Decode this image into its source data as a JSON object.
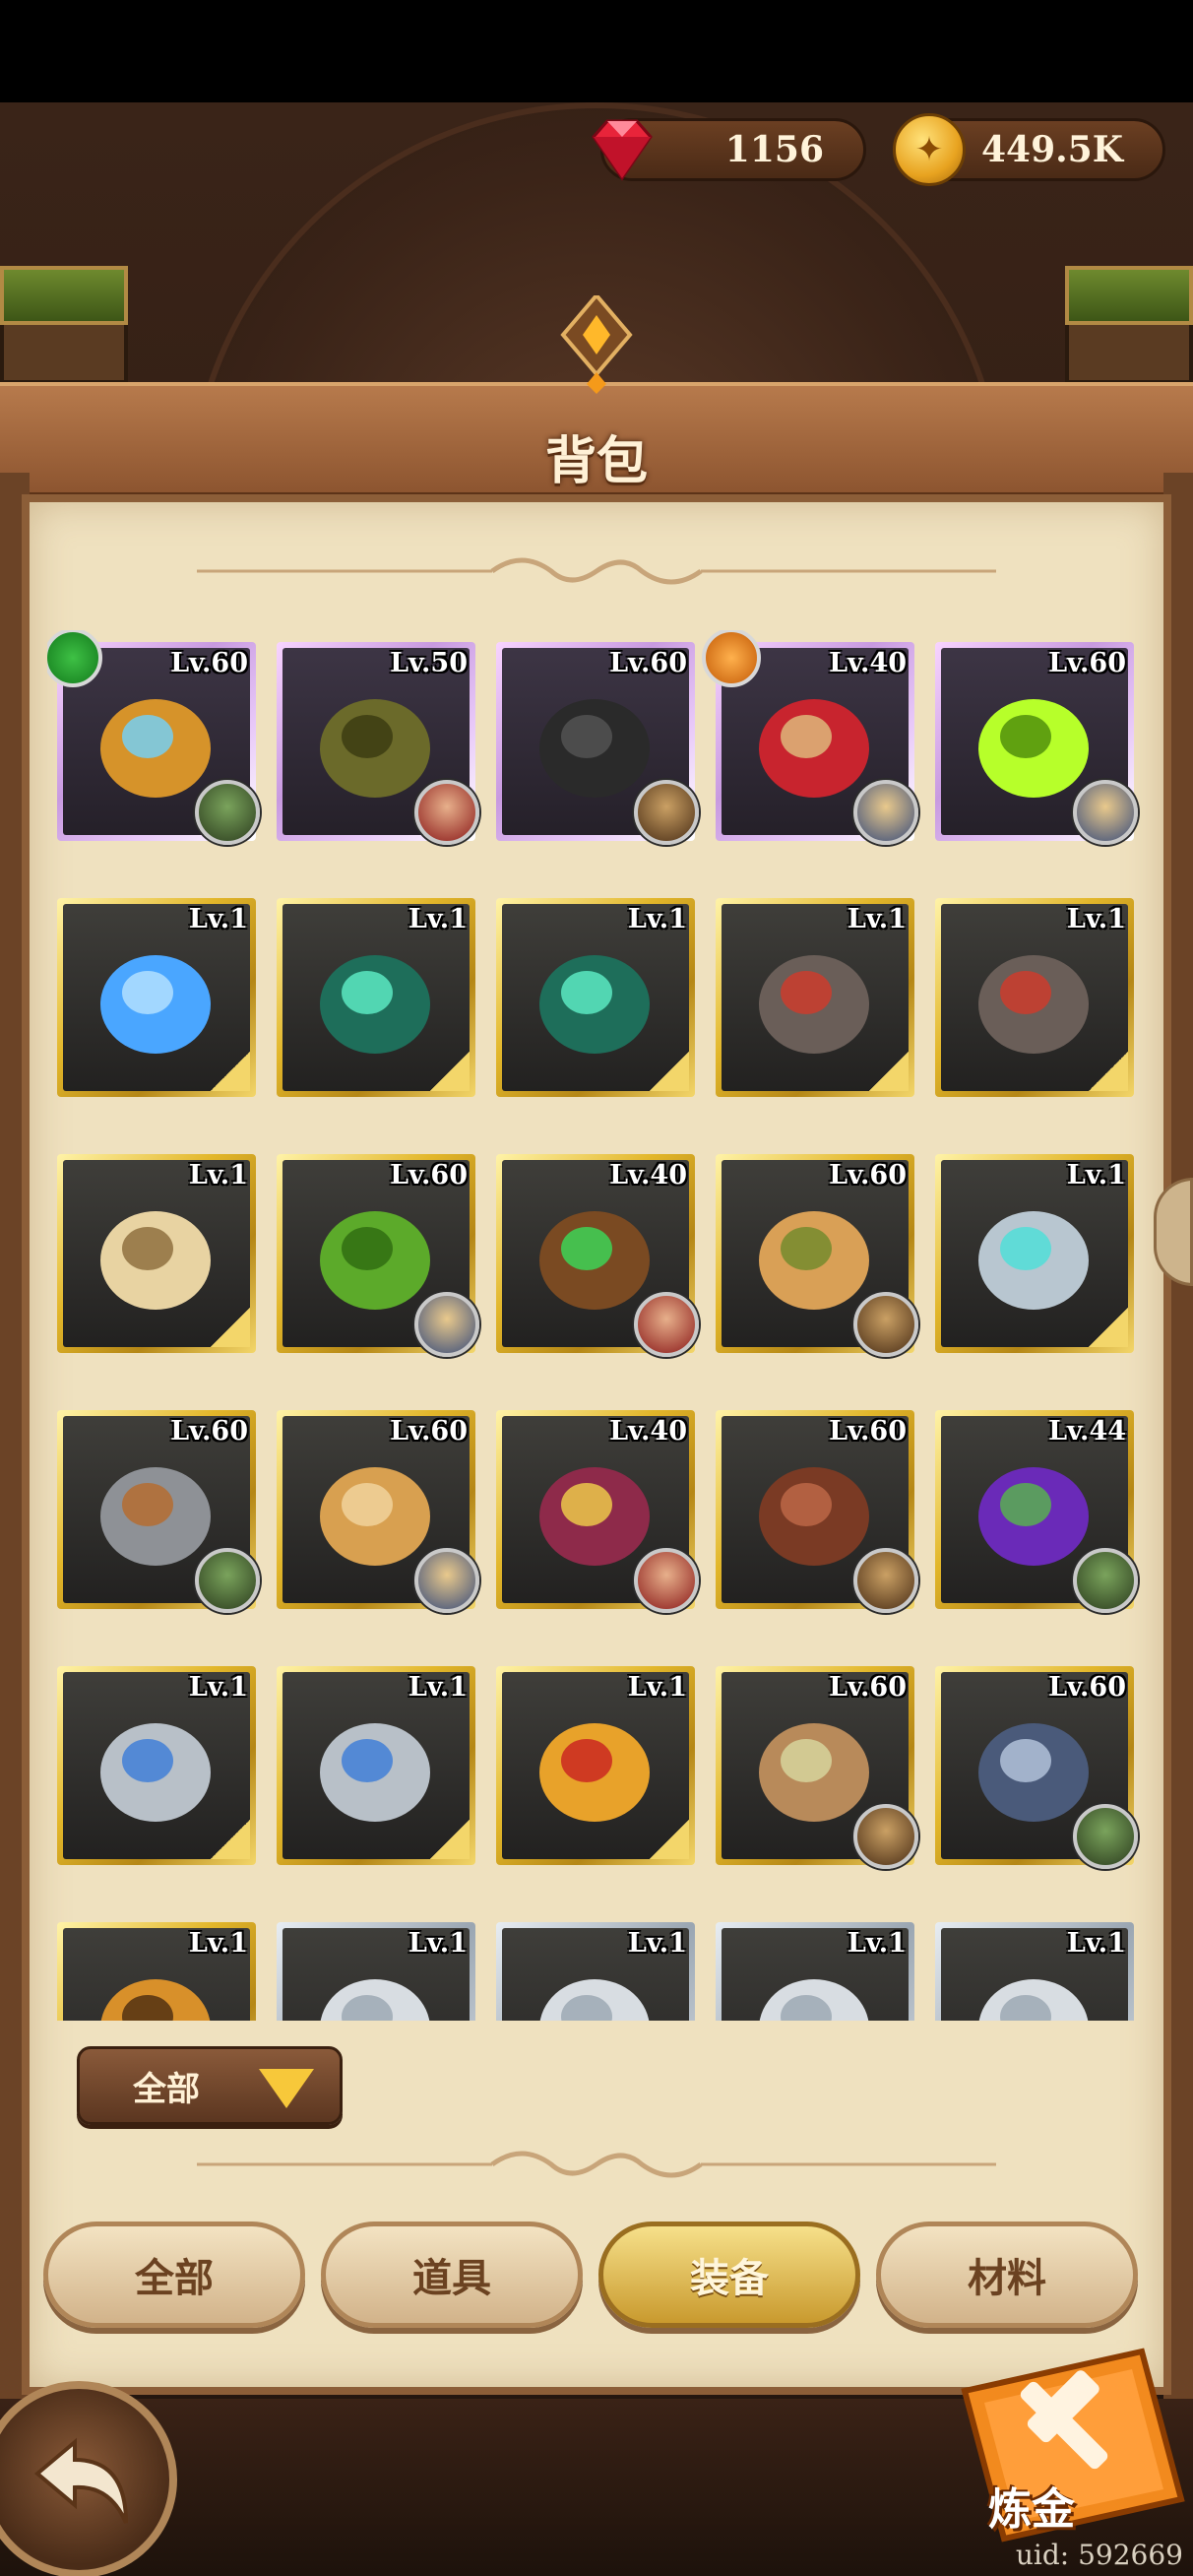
{
  "currencies": {
    "gems": {
      "value": "1156",
      "icon": "gem-icon"
    },
    "gold": {
      "value": "449.5K",
      "icon": "coin-icon"
    }
  },
  "title": "背包",
  "items": [
    {
      "level": "Lv.60",
      "frame": "purple",
      "hero": "green",
      "badge": "green",
      "art": "horn"
    },
    {
      "level": "Lv.50",
      "frame": "purple",
      "hero": "red",
      "art": "thorn-crown"
    },
    {
      "level": "Lv.60",
      "frame": "purple",
      "hero": "brown",
      "art": "horse"
    },
    {
      "level": "Lv.40",
      "frame": "purple",
      "hero": "blue",
      "badge": "orange",
      "art": "scepter"
    },
    {
      "level": "Lv.60",
      "frame": "purple",
      "hero": "blue",
      "art": "green-orb"
    },
    {
      "level": "Lv.1",
      "frame": "gold",
      "art": "blue-gem"
    },
    {
      "level": "Lv.1",
      "frame": "gold",
      "art": "teal-flame"
    },
    {
      "level": "Lv.1",
      "frame": "gold",
      "art": "teal-flame"
    },
    {
      "level": "Lv.1",
      "frame": "gold",
      "art": "rock"
    },
    {
      "level": "Lv.1",
      "frame": "gold",
      "art": "rock"
    },
    {
      "level": "Lv.1",
      "frame": "gold",
      "art": "map"
    },
    {
      "level": "Lv.60",
      "frame": "gold",
      "hero": "blue",
      "art": "turtle-shell"
    },
    {
      "level": "Lv.40",
      "frame": "gold",
      "hero": "red",
      "art": "vine-ring"
    },
    {
      "level": "Lv.60",
      "frame": "gold",
      "hero": "brown",
      "art": "straw-hat"
    },
    {
      "level": "Lv.1",
      "frame": "gold",
      "art": "fan"
    },
    {
      "level": "Lv.60",
      "frame": "gold",
      "hero": "green",
      "art": "helmet"
    },
    {
      "level": "Lv.60",
      "frame": "gold",
      "hero": "blue",
      "art": "tunic"
    },
    {
      "level": "Lv.40",
      "frame": "gold",
      "hero": "red",
      "art": "cape"
    },
    {
      "level": "Lv.60",
      "frame": "gold",
      "hero": "brown",
      "art": "leather-armor"
    },
    {
      "level": "Lv.44",
      "frame": "gold",
      "hero": "green",
      "art": "purple-armor"
    },
    {
      "level": "Lv.1",
      "frame": "gold",
      "art": "plate-armor"
    },
    {
      "level": "Lv.1",
      "frame": "gold",
      "art": "plate-armor"
    },
    {
      "level": "Lv.1",
      "frame": "gold",
      "art": "sword"
    },
    {
      "level": "Lv.60",
      "frame": "gold",
      "hero": "brown",
      "art": "bow"
    },
    {
      "level": "Lv.60",
      "frame": "gold",
      "hero": "green",
      "art": "mace"
    },
    {
      "level": "Lv.1",
      "frame": "gold",
      "art": "flames"
    },
    {
      "level": "Lv.1",
      "frame": "silver",
      "art": "hood"
    },
    {
      "level": "Lv.1",
      "frame": "silver",
      "art": "hood"
    },
    {
      "level": "Lv.1",
      "frame": "silver",
      "art": "hood"
    },
    {
      "level": "Lv.1",
      "frame": "silver",
      "art": "hood"
    }
  ],
  "filter": {
    "label": "全部"
  },
  "tabs": [
    {
      "label": "全部",
      "active": false
    },
    {
      "label": "道具",
      "active": false
    },
    {
      "label": "装备",
      "active": true
    },
    {
      "label": "材料",
      "active": false
    }
  ],
  "alchemy": {
    "label": "炼金"
  },
  "uid": "uid: 592669",
  "colors": {
    "accent": "#f7c83a",
    "panel": "#efe1bf",
    "frame_gold": "#e2b62a",
    "frame_purple": "#c89ae0"
  }
}
